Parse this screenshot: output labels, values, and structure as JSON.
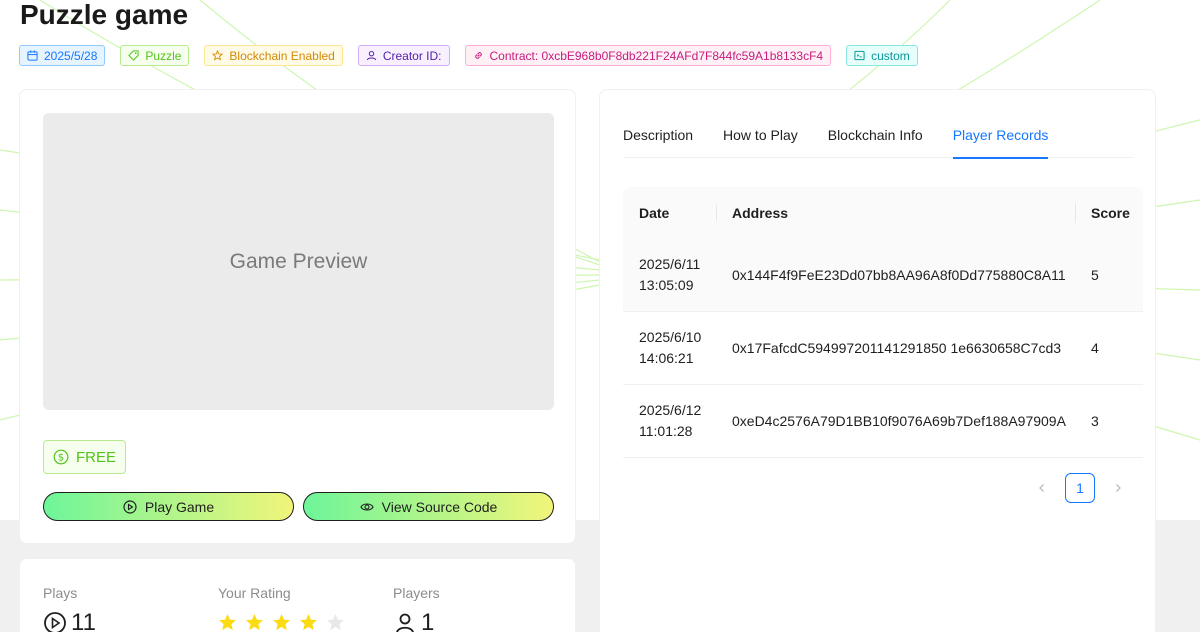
{
  "game": {
    "title": "Puzzle game"
  },
  "tags": {
    "date": "2025/5/28",
    "category": "Puzzle",
    "blockchain": "Blockchain Enabled",
    "creator": "Creator ID:",
    "contract": "Contract: 0xcbE968b0F8db221F24AFd7F844fc59A1b8133cF4",
    "custom": "custom"
  },
  "preview": {
    "label": "Game Preview"
  },
  "price": {
    "label": "FREE"
  },
  "actions": {
    "play_label": "Play Game",
    "source_label": "View Source Code"
  },
  "stats": {
    "plays_label": "Plays",
    "plays_value": "11",
    "rating_label": "Your Rating",
    "rating_value": 4,
    "rating_max": 5,
    "players_label": "Players",
    "players_value": "1"
  },
  "tabs": [
    {
      "label": "Description",
      "active": false
    },
    {
      "label": "How to Play",
      "active": false
    },
    {
      "label": "Blockchain Info",
      "active": false
    },
    {
      "label": "Player Records",
      "active": true
    }
  ],
  "records": {
    "columns": [
      "Date",
      "Address",
      "Score"
    ],
    "rows": [
      {
        "date": "2025/6/11\n13:05:09",
        "address": "0x144F4f9FeE23Dd07bb8AA96A8f0Dd775880C8A11",
        "score": "5"
      },
      {
        "date": "2025/6/10\n14:06:21",
        "address": "0x17FafcdC594997201141291850 1e6630658C7cd3",
        "score": "4"
      },
      {
        "date": "2025/6/12\n11:01:28",
        "address": "0xeD4c2576A79D1BB10f9076A69b7Def188A97909A",
        "score": "3"
      }
    ]
  },
  "pagination": {
    "current": "1",
    "prev_icon": "left-chevron-icon",
    "next_icon": "right-chevron-icon"
  },
  "colors": {
    "primary": "#1677ff",
    "success": "#52c41a",
    "star": "#fadb14",
    "button_gradient_start": "#6ef59a",
    "button_gradient_end": "#f1f57a"
  }
}
